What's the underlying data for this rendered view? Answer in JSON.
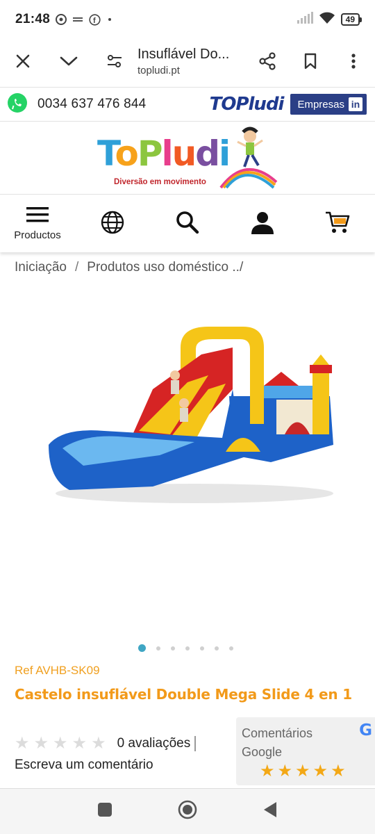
{
  "status_bar": {
    "time": "21:48",
    "battery": "49",
    "icons": [
      "chrome-icon",
      "vpn-icon",
      "facebook-icon",
      "dot-icon",
      "signal-icon",
      "wifi-icon",
      "battery-icon"
    ]
  },
  "custom_tab": {
    "title": "Insuflável Do...",
    "url": "topludi.pt",
    "icons": [
      "close-icon",
      "chevron-down-icon",
      "tune-icon",
      "share-icon",
      "bookmark-icon",
      "more-vert-icon"
    ]
  },
  "site_top": {
    "phone": "0034 637 476 844",
    "small_logo": "TOPludi",
    "empresas_label": "Empresas",
    "linkedin_label": "in"
  },
  "logo": {
    "letters": [
      "T",
      "o",
      "P",
      "l",
      "u",
      "d",
      "i"
    ],
    "tagline": "Diversão em movimento"
  },
  "nav": {
    "products_label": "Productos",
    "icons": [
      "menu-icon",
      "globe-icon",
      "search-icon",
      "user-icon",
      "cart-icon"
    ]
  },
  "breadcrumb": {
    "items": [
      "Iniciação",
      "Produtos uso doméstico ../"
    ],
    "separator": "/"
  },
  "gallery": {
    "total_images": 7,
    "active_index": 0
  },
  "product": {
    "ref": "Ref AVHB-SK09",
    "title": "Castelo insuflável Double Mega Slide 4 en 1",
    "rating": 0,
    "reviews": "0 avaliações",
    "write_comment": "Escreva um comentário"
  },
  "google_reviews": {
    "label": "Comentários Google",
    "stars": 5,
    "g_letter": "G"
  },
  "colors": {
    "accent_orange": "#f29a1a",
    "empresas_blue": "#2b3f86",
    "whatsapp_green": "#25d366",
    "dot_active": "#3fa6c4",
    "star_gold": "#f3a816"
  }
}
